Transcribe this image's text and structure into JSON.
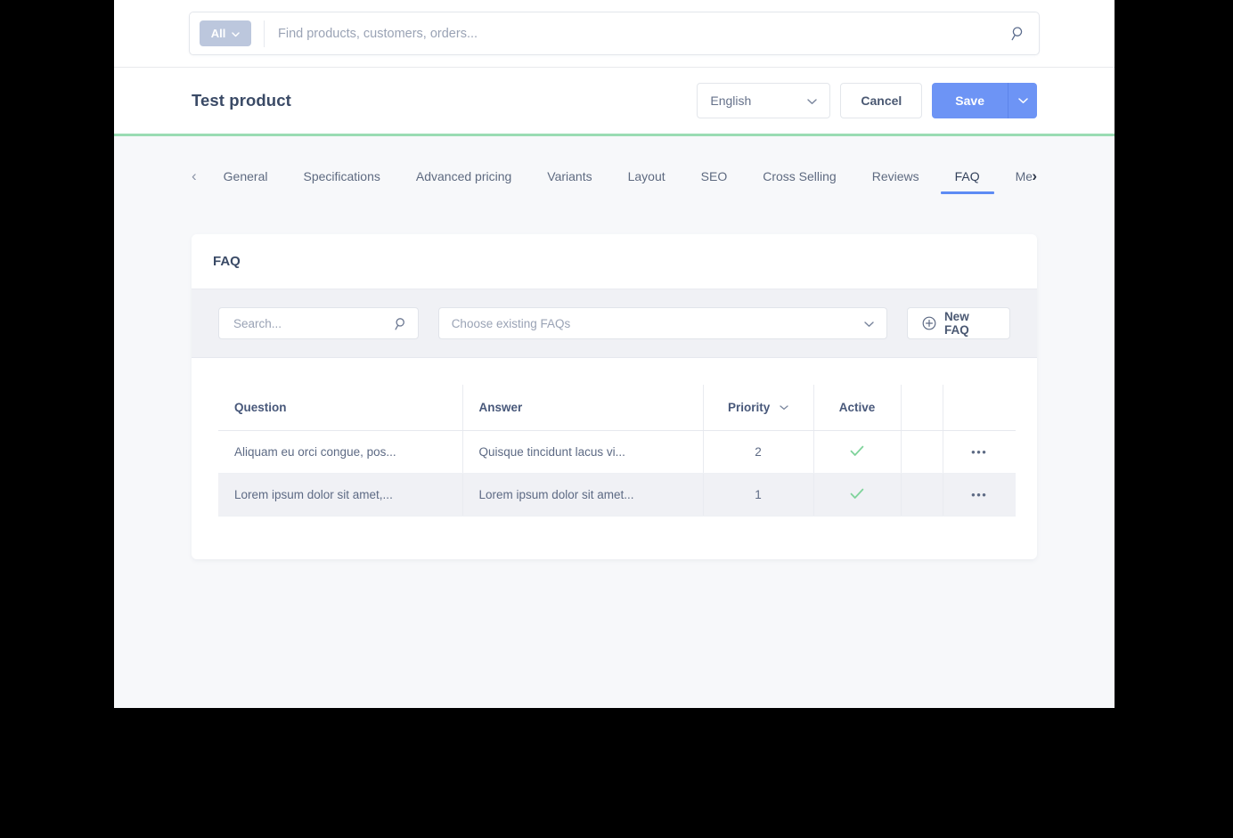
{
  "global_search": {
    "scope_label": "All",
    "placeholder": "Find products, customers, orders...",
    "value": "",
    "scope_icon": "chevron-down-icon",
    "search_icon": "search-icon"
  },
  "header": {
    "title": "Test product",
    "language": "English",
    "language_icon": "chevron-down-icon",
    "cancel_label": "Cancel",
    "save_label": "Save",
    "save_caret_icon": "chevron-down-icon",
    "accent_color": "#6d94f5",
    "progress_color": "#9adcb3"
  },
  "tabs": {
    "prev_icon": "chevron-left-icon",
    "next_icon": "chevron-right-icon",
    "active": "FAQ",
    "items": [
      {
        "label": "General"
      },
      {
        "label": "Specifications"
      },
      {
        "label": "Advanced pricing"
      },
      {
        "label": "Variants"
      },
      {
        "label": "Layout"
      },
      {
        "label": "SEO"
      },
      {
        "label": "Cross Selling"
      },
      {
        "label": "Reviews"
      },
      {
        "label": "FAQ"
      },
      {
        "label": "Medi"
      }
    ]
  },
  "card": {
    "title": "FAQ",
    "toolbar": {
      "search_placeholder": "Search...",
      "search_value": "",
      "search_icon": "search-icon",
      "choose_placeholder": "Choose existing FAQs",
      "choose_icon": "chevron-down-icon",
      "new_label": "New FAQ",
      "new_icon": "plus-circle-icon"
    },
    "table": {
      "columns": [
        {
          "label": "Question"
        },
        {
          "label": "Answer"
        },
        {
          "label": "Priority",
          "sort_icon": "chevron-down-icon"
        },
        {
          "label": "Active"
        },
        {
          "label": ""
        },
        {
          "label": ""
        }
      ],
      "rows": [
        {
          "question": "Aliquam eu orci congue, pos...",
          "answer": "Quisque tincidunt lacus vi...",
          "priority": "2",
          "active": "✓",
          "menu_icon": "ellipsis-icon",
          "menu_label": "•••"
        },
        {
          "question": "Lorem ipsum dolor sit amet,...",
          "answer": "Lorem ipsum dolor sit amet...",
          "priority": "1",
          "active": "✓",
          "menu_icon": "ellipsis-icon",
          "menu_label": "•••"
        }
      ]
    }
  }
}
